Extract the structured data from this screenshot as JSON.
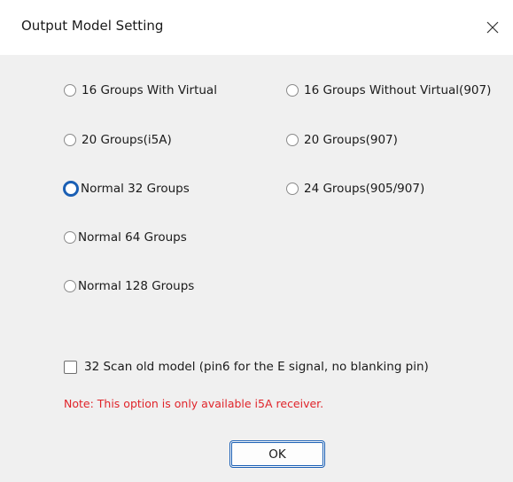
{
  "window": {
    "title": "Output Model Setting",
    "close_icon": "close-icon"
  },
  "options": [
    {
      "id": "16-virtual",
      "label": "16 Groups With Virtual",
      "selected": false
    },
    {
      "id": "16-no-virtual",
      "label": "16 Groups Without Virtual(907)",
      "selected": false
    },
    {
      "id": "20-i5a",
      "label": "20 Groups(i5A)",
      "selected": false
    },
    {
      "id": "20-907",
      "label": "20 Groups(907)",
      "selected": false
    },
    {
      "id": "normal-32",
      "label": "Normal 32 Groups",
      "selected": true
    },
    {
      "id": "24-905-907",
      "label": "24 Groups(905/907)",
      "selected": false
    },
    {
      "id": "normal-64",
      "label": "Normal 64 Groups",
      "selected": false
    },
    {
      "id": "normal-128",
      "label": "Normal 128 Groups",
      "selected": false
    }
  ],
  "checkbox": {
    "label": "32 Scan old model (pin6 for the E signal, no blanking pin)",
    "checked": false
  },
  "note": "Note: This option is only available i5A receiver.",
  "buttons": {
    "ok_label": "OK"
  },
  "colors": {
    "accent": "#1a5fb4",
    "note": "#e0242a",
    "content_bg": "#f0f0f0"
  }
}
